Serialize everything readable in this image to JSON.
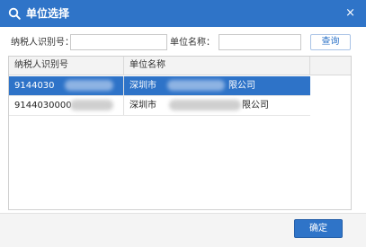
{
  "dialog": {
    "title": "单位选择",
    "close_glyph": "×",
    "title_icon": "search-icon"
  },
  "filters": {
    "tax_id_label": "纳税人识别号：",
    "tax_id_value": "",
    "unit_name_label": "单位名称：",
    "unit_name_value": "",
    "query_button": "查询"
  },
  "table": {
    "columns": [
      "纳税人识别号",
      "单位名称"
    ],
    "rows": [
      {
        "tax_id_prefix": "9144030",
        "name_prefix": "深圳市",
        "name_suffix": "限公司",
        "selected": true
      },
      {
        "tax_id_prefix": "9144030000",
        "name_prefix": "深圳市",
        "name_suffix": "限公司",
        "selected": false
      }
    ]
  },
  "footer": {
    "confirm_button": "确定"
  },
  "colors": {
    "accent": "#2f74c8",
    "selected_row": "#2e73c8"
  }
}
